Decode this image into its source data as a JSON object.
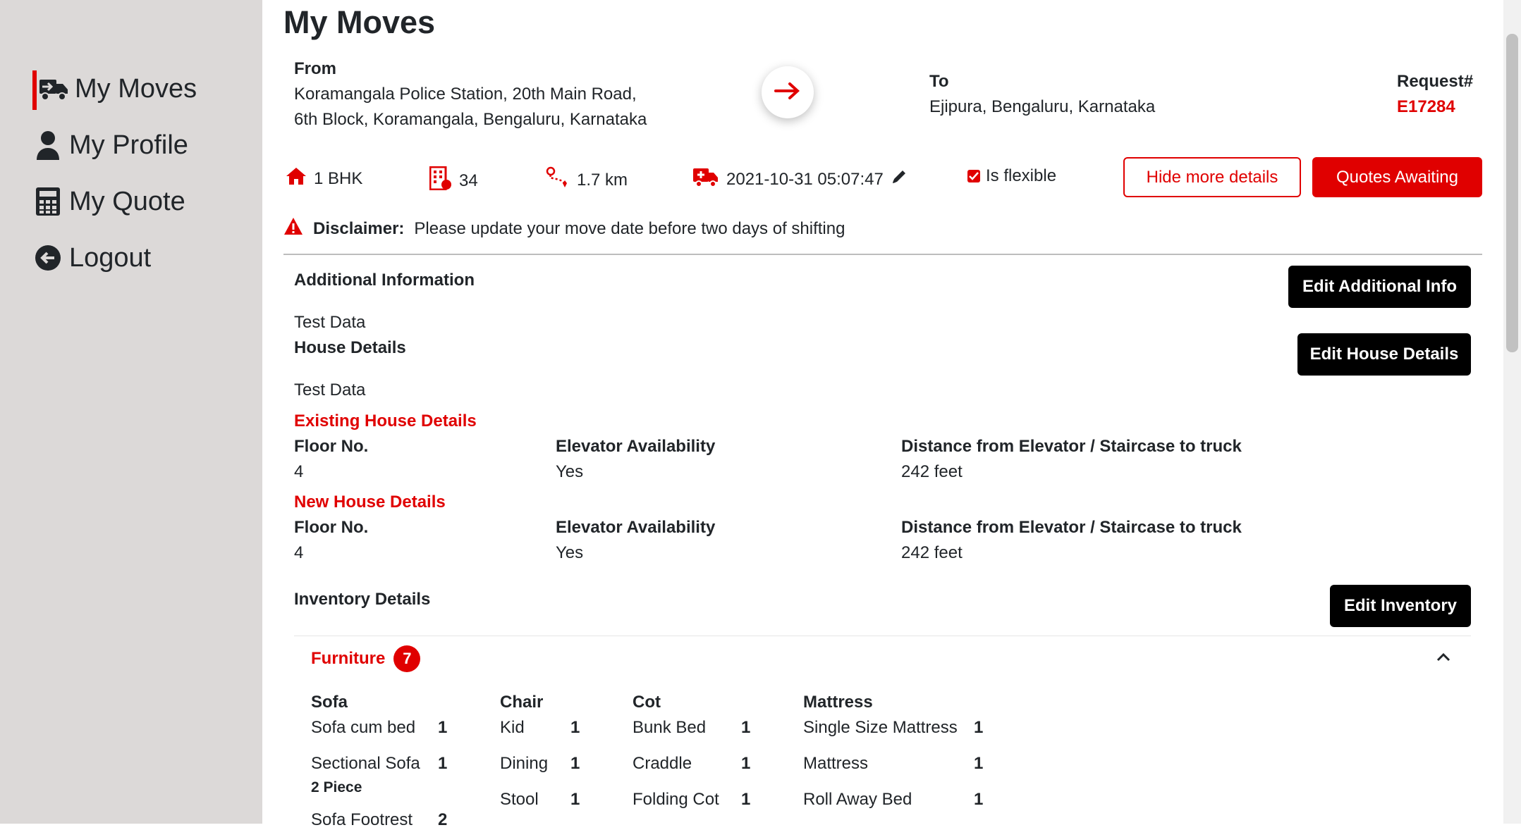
{
  "sidebar": {
    "items": [
      {
        "label": "My Moves",
        "icon": "truck-arrow-icon"
      },
      {
        "label": "My Profile",
        "icon": "user-icon"
      },
      {
        "label": "My Quote",
        "icon": "calculator-icon"
      },
      {
        "label": "Logout",
        "icon": "logout-icon"
      }
    ]
  },
  "page": {
    "title": "My Moves"
  },
  "move": {
    "from_label": "From",
    "from_line1": "Koramangala Police Station, 20th Main Road,",
    "from_line2": "6th Block, Koramangala, Bengaluru, Karnataka",
    "to_label": "To",
    "to_address": "Ejipura, Bengaluru, Karnataka",
    "request_label": "Request#",
    "request_id": "E17284"
  },
  "stats": {
    "bhk": "1 BHK",
    "floors": "34",
    "distance": "1.7 km",
    "datetime": "2021-10-31 05:07:47",
    "flexible_label": "Is flexible"
  },
  "buttons": {
    "hide_details": "Hide more details",
    "quotes_awaiting": "Quotes Awaiting",
    "edit_additional": "Edit Additional Info",
    "edit_house": "Edit House Details",
    "edit_inventory": "Edit Inventory"
  },
  "disclaimer": {
    "label": "Disclaimer:",
    "text": "Please update your move date before two days of shifting"
  },
  "additional": {
    "title": "Additional Information",
    "value": "Test Data"
  },
  "house": {
    "title": "House Details",
    "value": "Test Data",
    "existing": {
      "title": "Existing House Details",
      "floor_label": "Floor No.",
      "floor": "4",
      "elevator_label": "Elevator Availability",
      "elevator": "Yes",
      "distance_label": "Distance from Elevator / Staircase to truck",
      "distance": "242 feet"
    },
    "new": {
      "title": "New House Details",
      "floor_label": "Floor No.",
      "floor": "4",
      "elevator_label": "Elevator Availability",
      "elevator": "Yes",
      "distance_label": "Distance from Elevator / Staircase to truck",
      "distance": "242 feet"
    }
  },
  "inventory": {
    "title": "Inventory Details",
    "category": "Furniture",
    "count": "7",
    "groups": {
      "sofa": {
        "title": "Sofa",
        "items": [
          {
            "name": "Sofa cum bed",
            "qty": "1"
          },
          {
            "name": "Sectional Sofa",
            "qty": "1",
            "sub": "2 Piece"
          },
          {
            "name": "Sofa Footrest",
            "qty": "2"
          }
        ]
      },
      "chair": {
        "title": "Chair",
        "items": [
          {
            "name": "Kid",
            "qty": "1"
          },
          {
            "name": "Dining",
            "qty": "1"
          },
          {
            "name": "Stool",
            "qty": "1"
          }
        ]
      },
      "cot": {
        "title": "Cot",
        "items": [
          {
            "name": "Bunk Bed",
            "qty": "1"
          },
          {
            "name": "Craddle",
            "qty": "1"
          },
          {
            "name": "Folding Cot",
            "qty": "1"
          }
        ]
      },
      "mattress": {
        "title": "Mattress",
        "items": [
          {
            "name": "Single Size Mattress",
            "qty": "1"
          },
          {
            "name": "Mattress",
            "qty": "1"
          },
          {
            "name": "Roll Away Bed",
            "qty": "1"
          }
        ]
      }
    }
  },
  "colors": {
    "accent": "#e00000",
    "sidebar_bg": "#dcd9d8",
    "dark_button": "#000000"
  }
}
